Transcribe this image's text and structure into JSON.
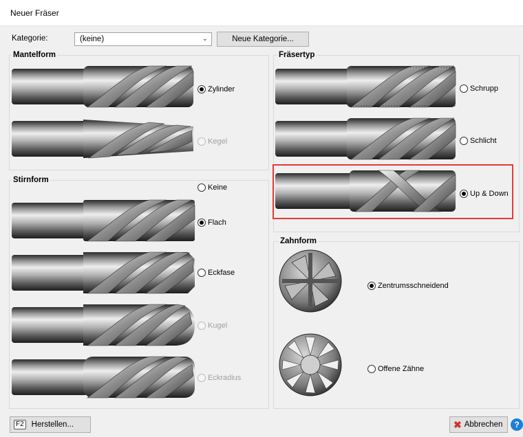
{
  "window": {
    "title": "Neuer Fräser"
  },
  "category": {
    "label": "Kategorie:",
    "value": "(keine)",
    "new_button": "Neue Kategorie..."
  },
  "mantelform": {
    "title": "Mantelform",
    "options": [
      {
        "label": "Zylinder",
        "selected": true,
        "enabled": true
      },
      {
        "label": "Kegel",
        "selected": false,
        "enabled": false
      }
    ]
  },
  "stirnform": {
    "title": "Stirnform",
    "options": [
      {
        "label": "Keine",
        "selected": false,
        "enabled": true
      },
      {
        "label": "Flach",
        "selected": true,
        "enabled": true
      },
      {
        "label": "Eckfase",
        "selected": false,
        "enabled": true
      },
      {
        "label": "Kugel",
        "selected": false,
        "enabled": false
      },
      {
        "label": "Eckradius",
        "selected": false,
        "enabled": false
      }
    ]
  },
  "fraesertyp": {
    "title": "Fräsertyp",
    "options": [
      {
        "label": "Schrupp",
        "selected": false,
        "enabled": true
      },
      {
        "label": "Schlicht",
        "selected": false,
        "enabled": true
      },
      {
        "label": "Up & Down",
        "selected": true,
        "enabled": true
      }
    ]
  },
  "zahnform": {
    "title": "Zahnform",
    "options": [
      {
        "label": "Zentrumsschneidend",
        "selected": true,
        "enabled": true
      },
      {
        "label": "Offene Zähne",
        "selected": false,
        "enabled": true
      }
    ]
  },
  "footer": {
    "key_label": "F2",
    "create_button": "Herstellen...",
    "cancel_button": "Abbrechen",
    "help_icon": "help-icon"
  },
  "colors": {
    "highlight": "#e53935",
    "help": "#1e7fd6",
    "cancel_x": "#d32f2f"
  }
}
